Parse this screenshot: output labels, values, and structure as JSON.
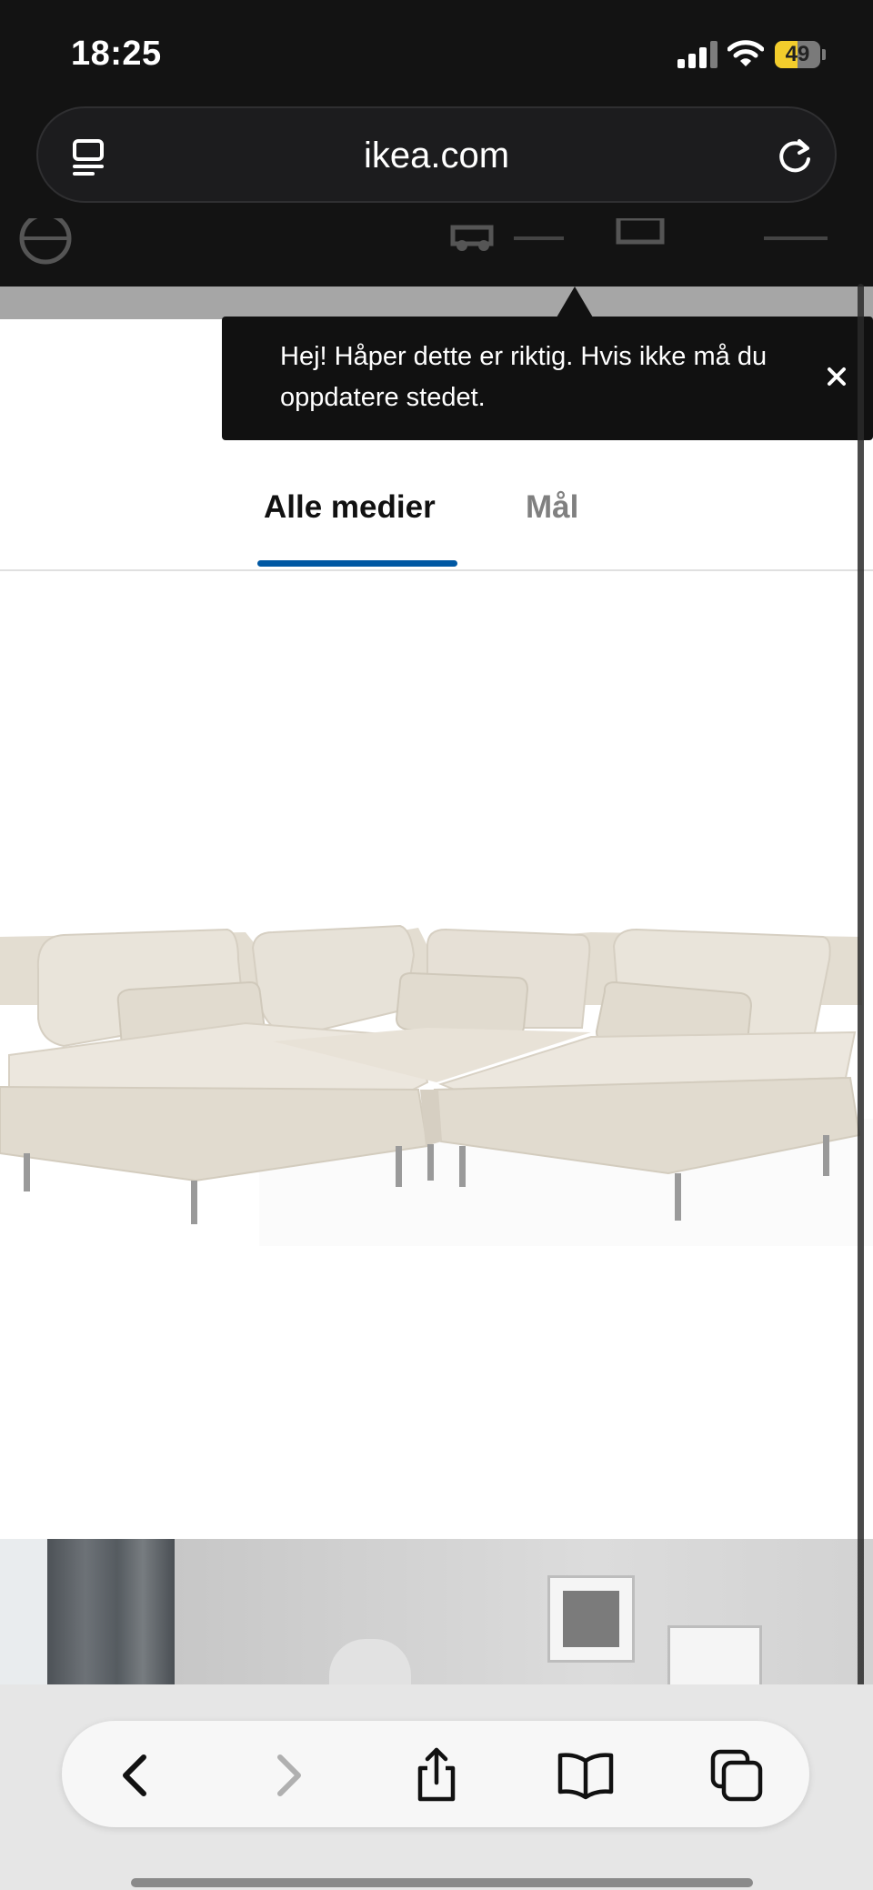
{
  "status_bar": {
    "time": "18:25",
    "battery_percent": 49,
    "battery_label": "49"
  },
  "browser": {
    "url": "ikea.com"
  },
  "tooltip": {
    "text": "Hej! Håper dette er riktig. Hvis ikke må du oppdatere stedet."
  },
  "media_tabs": [
    {
      "label": "Alle medier",
      "selected": true
    },
    {
      "label": "Mål",
      "selected": false
    }
  ],
  "product_image": {
    "subject": "3-seters hjørnesofa, beige"
  },
  "colors": {
    "accent_blue": "#0058a3",
    "chrome_dark": "#131313",
    "sofa_fabric": "#e4ded3",
    "battery_yellow": "#f3cd2c"
  },
  "toolbar": {
    "icons": [
      "back-icon",
      "forward-icon",
      "share-icon",
      "bookmarks-icon",
      "tabs-icon"
    ]
  }
}
